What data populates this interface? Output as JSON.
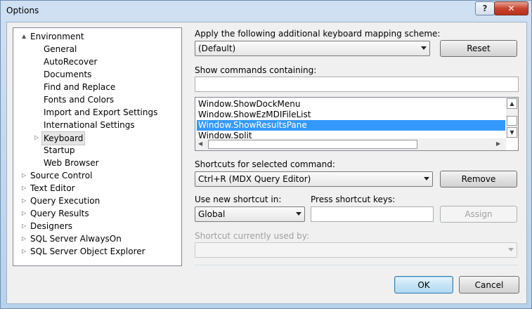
{
  "window": {
    "title": "Options"
  },
  "tree": [
    {
      "label": "Environment",
      "expander": "▲",
      "indent": 0,
      "expanded": true
    },
    {
      "label": "General",
      "indent": 1
    },
    {
      "label": "AutoRecover",
      "indent": 1
    },
    {
      "label": "Documents",
      "indent": 1
    },
    {
      "label": "Find and Replace",
      "indent": 1
    },
    {
      "label": "Fonts and Colors",
      "indent": 1
    },
    {
      "label": "Import and Export Settings",
      "indent": 1
    },
    {
      "label": "International Settings",
      "indent": 1
    },
    {
      "label": "Keyboard",
      "indent": 1,
      "selected": true,
      "expander": "▷"
    },
    {
      "label": "Startup",
      "indent": 1
    },
    {
      "label": "Web Browser",
      "indent": 1
    },
    {
      "label": "Source Control",
      "indent": 0,
      "expander": "▷"
    },
    {
      "label": "Text Editor",
      "indent": 0,
      "expander": "▷"
    },
    {
      "label": "Query Execution",
      "indent": 0,
      "expander": "▷"
    },
    {
      "label": "Query Results",
      "indent": 0,
      "expander": "▷"
    },
    {
      "label": "Designers",
      "indent": 0,
      "expander": "▷"
    },
    {
      "label": "SQL Server AlwaysOn",
      "indent": 0,
      "expander": "▷"
    },
    {
      "label": "SQL Server Object Explorer",
      "indent": 0,
      "expander": "▷"
    }
  ],
  "mapping": {
    "label": "Apply the following additional keyboard mapping scheme:",
    "value": "(Default)",
    "reset_label": "Reset"
  },
  "commands": {
    "label": "Show commands containing:",
    "filter_value": "",
    "items": [
      "Window.ShowDockMenu",
      "Window.ShowEzMDIFileList",
      "Window.ShowResultsPane",
      "Window.Split"
    ],
    "selected_index": 2
  },
  "shortcuts": {
    "label": "Shortcuts for selected command:",
    "value": "Ctrl+R (MDX Query Editor)",
    "remove_label": "Remove"
  },
  "new_shortcut": {
    "use_label": "Use new shortcut in:",
    "scope_value": "Global",
    "press_label": "Press shortcut keys:",
    "keys_value": "",
    "assign_label": "Assign"
  },
  "used_by": {
    "label": "Shortcut currently used by:",
    "value": ""
  },
  "footer": {
    "ok_label": "OK",
    "cancel_label": "Cancel"
  },
  "icons": {
    "help": "?",
    "close": "✕",
    "scroll_up": "▲",
    "scroll_down": "▼",
    "scroll_left": "◀",
    "scroll_right": "▶"
  },
  "colors": {
    "selection": "#3399ff",
    "close_button": "#c8432e"
  }
}
